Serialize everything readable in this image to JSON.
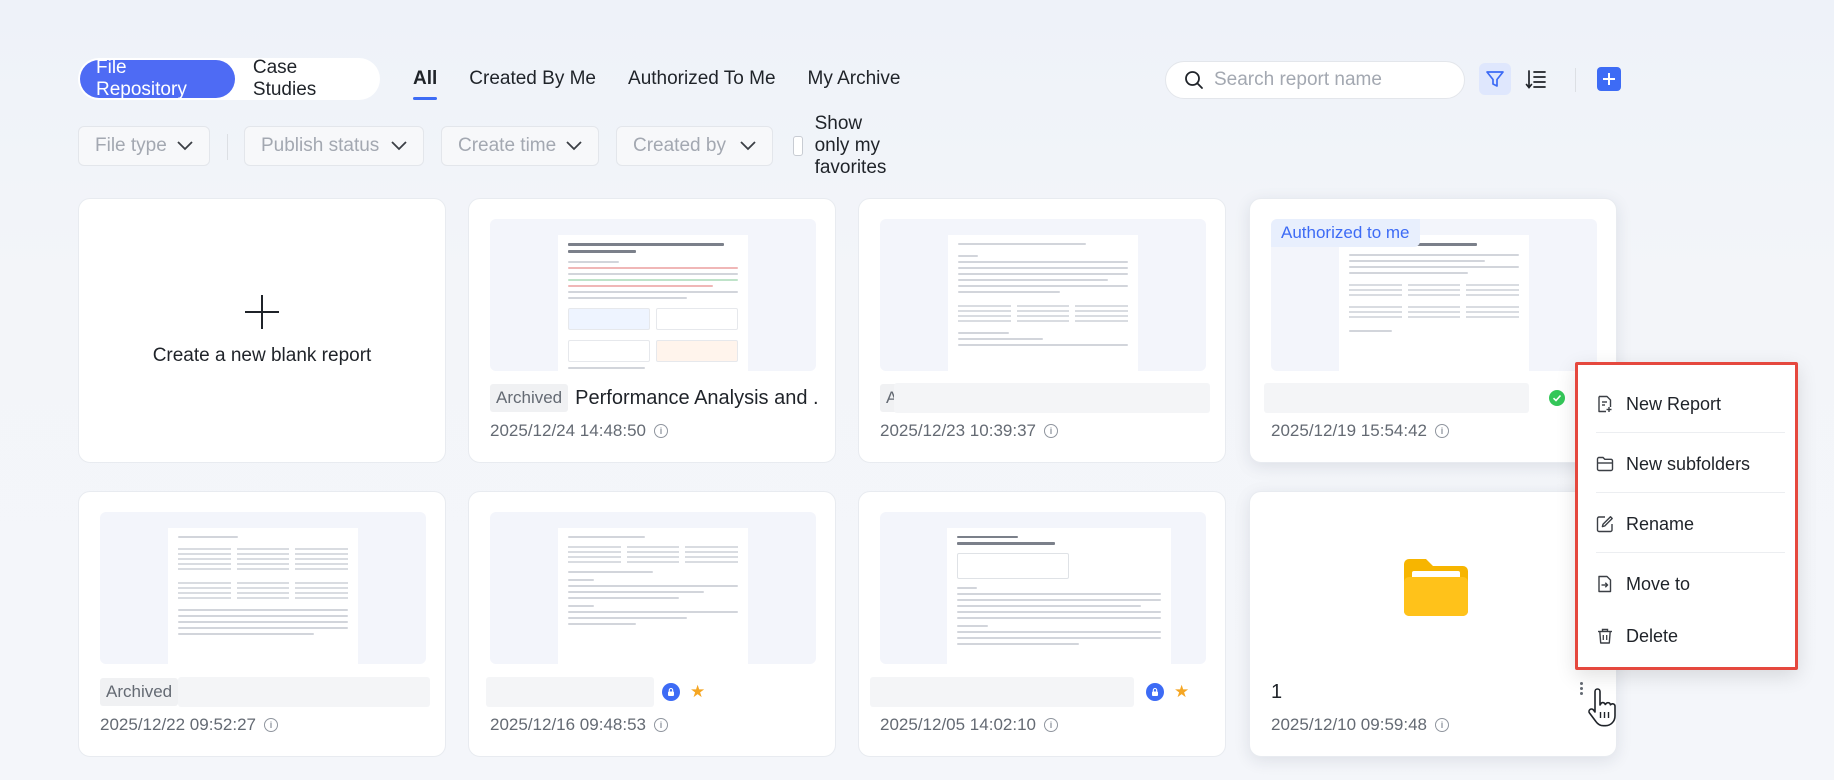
{
  "header": {
    "segments": [
      {
        "label": "File Repository",
        "active": true
      },
      {
        "label": "Case Studies",
        "active": false
      }
    ],
    "tabs": [
      {
        "label": "All",
        "active": true
      },
      {
        "label": "Created By Me",
        "active": false
      },
      {
        "label": "Authorized To Me",
        "active": false
      },
      {
        "label": "My Archive",
        "active": false
      }
    ],
    "search": {
      "placeholder": "Search report name",
      "value": ""
    },
    "icons": [
      "search-icon",
      "filter-icon",
      "sort-icon",
      "add-icon"
    ],
    "accent_color": "#3d6bf5"
  },
  "filters": {
    "file_type": "File type",
    "publish_status": "Publish status",
    "create_time": "Create time",
    "created_by": "Created by",
    "favorites_label": "Show only my favorites",
    "favorites_checked": false
  },
  "cards": {
    "blank": {
      "label": "Create a new blank report"
    },
    "items": [
      {
        "badge": "",
        "tag": "Archived",
        "title": "Performance Analysis and ...",
        "time": "2025/12/24 14:48:50"
      },
      {
        "badge": "",
        "tag": "Archived",
        "title": "",
        "time": "2025/12/23 10:39:37"
      },
      {
        "badge": "Authorized to me",
        "tag": "",
        "title": "",
        "time": "2025/12/19 15:54:42"
      },
      {
        "badge": "",
        "tag": "Archived",
        "title": "",
        "time": "2025/12/22 09:52:27"
      },
      {
        "badge": "",
        "tag": "",
        "title": "",
        "time": "2025/12/16 09:48:53"
      },
      {
        "badge": "",
        "tag": "",
        "title": "",
        "time": "2025/12/05 14:02:10"
      },
      {
        "badge": "",
        "tag": "",
        "title": "1",
        "time": "2025/12/10 09:59:48",
        "type": "folder"
      }
    ]
  },
  "context_menu": {
    "items": [
      {
        "label": "New Report",
        "icon": "new-report-icon"
      },
      {
        "label": "New subfolders",
        "icon": "folder-icon"
      },
      {
        "label": "Rename",
        "icon": "edit-icon"
      },
      {
        "label": "Move to",
        "icon": "move-icon"
      },
      {
        "label": "Delete",
        "icon": "trash-icon"
      }
    ],
    "highlight_color": "#e5483e"
  }
}
